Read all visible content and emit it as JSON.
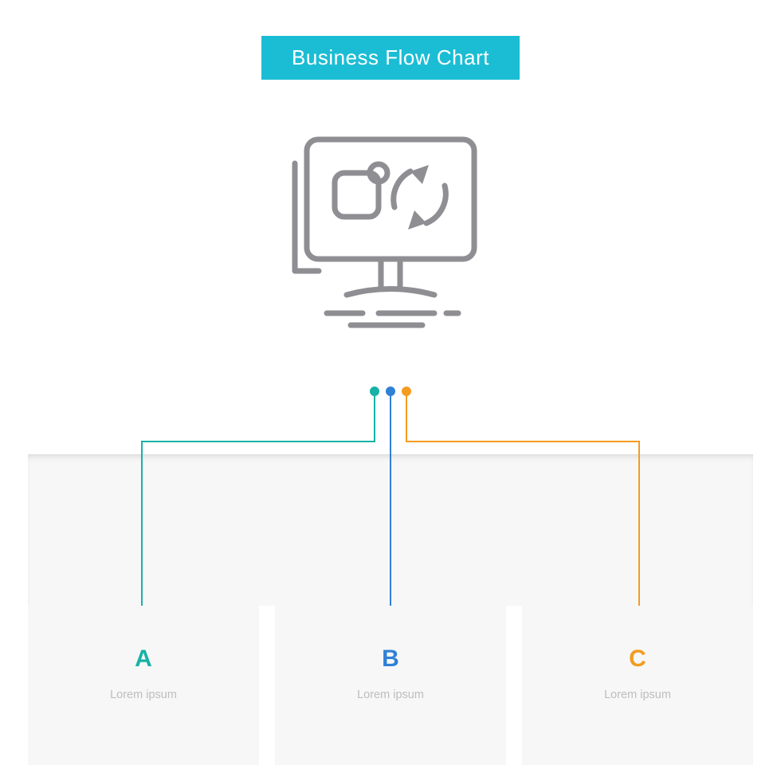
{
  "title": "Business Flow Chart",
  "icon": "computer-sync-icon",
  "colors": {
    "a": "#17b2a5",
    "b": "#2f80d6",
    "c": "#f39c1f",
    "banner": "#1bbdd4",
    "icon": "#8e8e93"
  },
  "steps": [
    {
      "letter": "A",
      "text": "Lorem ipsum",
      "color": "#17b2a5"
    },
    {
      "letter": "B",
      "text": "Lorem ipsum",
      "color": "#2f80d6"
    },
    {
      "letter": "C",
      "text": "Lorem ipsum",
      "color": "#f39c1f"
    }
  ]
}
